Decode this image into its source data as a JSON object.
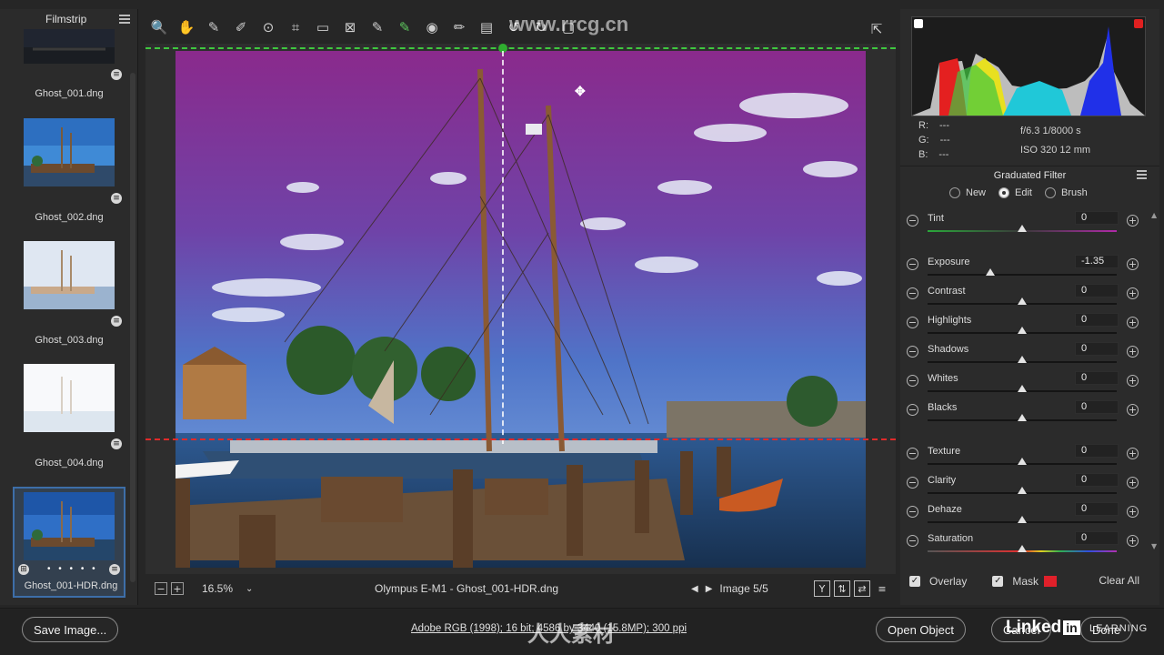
{
  "filmstrip": {
    "title": "Filmstrip",
    "items": [
      {
        "label": "Ghost_001.dng"
      },
      {
        "label": "Ghost_002.dng"
      },
      {
        "label": "Ghost_003.dng"
      },
      {
        "label": "Ghost_004.dng"
      },
      {
        "label": "Ghost_001-HDR.dng",
        "selected": true
      }
    ],
    "selected_dots": "• • • • •"
  },
  "toolbar": {
    "tools": [
      {
        "name": "zoom-icon",
        "glyph": "🔍"
      },
      {
        "name": "hand-icon",
        "glyph": "✋"
      },
      {
        "name": "white-balance-icon",
        "glyph": "✎"
      },
      {
        "name": "color-sampler-icon",
        "glyph": "✐"
      },
      {
        "name": "targeted-adjust-icon",
        "glyph": "⊙"
      },
      {
        "name": "crop-icon",
        "glyph": "⌗"
      },
      {
        "name": "straighten-icon",
        "glyph": "▭"
      },
      {
        "name": "transform-icon",
        "glyph": "⊠"
      },
      {
        "name": "spot-removal-icon",
        "glyph": "✎"
      },
      {
        "name": "graduated-filter-icon",
        "glyph": "✎"
      },
      {
        "name": "red-eye-icon",
        "glyph": "◉"
      },
      {
        "name": "brush-icon",
        "glyph": "✏"
      },
      {
        "name": "preferences-icon",
        "glyph": "▤"
      },
      {
        "name": "rotate-left-icon",
        "glyph": "↺"
      },
      {
        "name": "rotate-right-icon",
        "glyph": "↻"
      },
      {
        "name": "delete-icon",
        "glyph": "▢"
      }
    ],
    "export_glyph": "⇱"
  },
  "statusbar": {
    "zoom_out": "−",
    "zoom_in": "+",
    "zoom_value": "16.5%",
    "zoom_dropdown": "⌄",
    "camera_file": "Olympus E-M1  -  Ghost_001-HDR.dng",
    "prev": "◀",
    "next": "▶",
    "image_counter": "Image 5/5",
    "view_icons": [
      "Y",
      "⇅",
      "⇄",
      "≡"
    ]
  },
  "info": {
    "r_label": "R:",
    "g_label": "G:",
    "b_label": "B:",
    "r_value": "---",
    "g_value": "---",
    "b_value": "---",
    "aperture_shutter": "f/6.3   1/8000 s",
    "iso_focal": "ISO 320   12 mm"
  },
  "panel": {
    "title": "Graduated Filter",
    "modes": [
      {
        "label": "New",
        "checked": false
      },
      {
        "label": "Edit",
        "checked": true
      },
      {
        "label": "Brush",
        "checked": false
      }
    ],
    "sliders": [
      {
        "label": "Tint",
        "value": "0",
        "pos": 0.5,
        "track": "tint"
      },
      {
        "label": "Exposure",
        "value": "-1.35",
        "pos": 0.33,
        "track": "plain"
      },
      {
        "label": "Contrast",
        "value": "0",
        "pos": 0.5,
        "track": "plain"
      },
      {
        "label": "Highlights",
        "value": "0",
        "pos": 0.5,
        "track": "plain"
      },
      {
        "label": "Shadows",
        "value": "0",
        "pos": 0.5,
        "track": "plain"
      },
      {
        "label": "Whites",
        "value": "0",
        "pos": 0.5,
        "track": "plain"
      },
      {
        "label": "Blacks",
        "value": "0",
        "pos": 0.5,
        "track": "plain"
      },
      {
        "label": "Texture",
        "value": "0",
        "pos": 0.5,
        "track": "plain"
      },
      {
        "label": "Clarity",
        "value": "0",
        "pos": 0.5,
        "track": "plain"
      },
      {
        "label": "Dehaze",
        "value": "0",
        "pos": 0.5,
        "track": "plain"
      },
      {
        "label": "Saturation",
        "value": "0",
        "pos": 0.5,
        "track": "saturation"
      }
    ],
    "overlay_label": "Overlay",
    "mask_label": "Mask",
    "clear_all": "Clear All",
    "mask_color": "#e0202a"
  },
  "footer": {
    "save_image": "Save Image...",
    "workflow": "Adobe RGB (1998); 16 bit; 4586 by 3440 (15.8MP); 300 ppi",
    "open_object": "Open Object",
    "cancel": "Cancel",
    "done": "Done"
  },
  "watermarks": {
    "site": "www.rrcg.cn",
    "brand": "人人素材",
    "linkedin": "Linked",
    "linkedin_in": "in",
    "learning": "LEARNING"
  },
  "colors": {
    "accent": "#3d6ea8",
    "guide_green": "#3fc83f",
    "guide_red": "#e02a2a"
  }
}
